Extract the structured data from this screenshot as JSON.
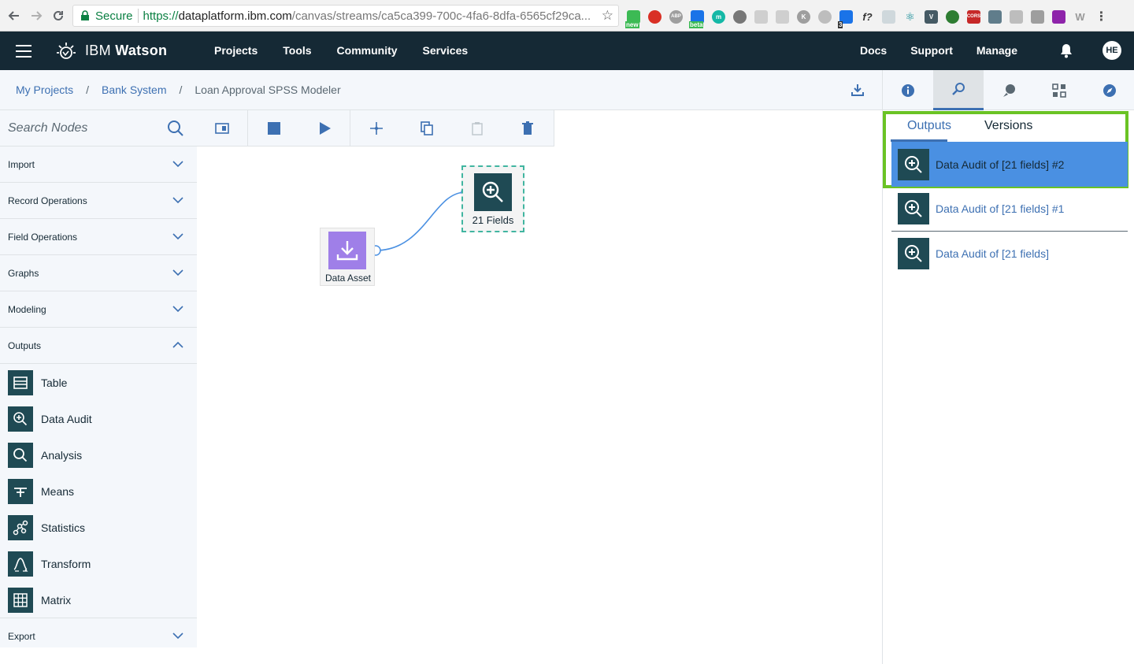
{
  "browser": {
    "secure_label": "Secure",
    "url_scheme": "https://",
    "url_host": "dataplatform.ibm.com",
    "url_path": "/canvas/streams/ca5ca399-700c-4fa6-8dfa-6565cf29ca...",
    "extension_labels": {
      "new": "new",
      "beta": "beta",
      "badge_count": "3"
    }
  },
  "header": {
    "brand_prefix": "IBM ",
    "brand_name": "Watson",
    "nav": [
      "Projects",
      "Tools",
      "Community",
      "Services"
    ],
    "right_nav": [
      "Docs",
      "Support",
      "Manage"
    ],
    "avatar_initials": "HE"
  },
  "breadcrumb": {
    "items": [
      "My Projects",
      "Bank System"
    ],
    "separator": "/",
    "current": "Loan Approval SPSS Modeler"
  },
  "palette": {
    "search_placeholder": "Search Nodes",
    "categories_top": [
      "Import",
      "Record Operations",
      "Field Operations",
      "Graphs",
      "Modeling",
      "Outputs"
    ],
    "output_nodes": [
      "Table",
      "Data Audit",
      "Analysis",
      "Means",
      "Statistics",
      "Transform",
      "Matrix"
    ],
    "category_bottom": "Export"
  },
  "canvas": {
    "nodes": [
      {
        "label": "Data Asset",
        "icon": "download-icon"
      },
      {
        "label": "21 Fields",
        "icon": "zoom-in-icon"
      }
    ]
  },
  "right_panel": {
    "tabs": [
      "info-icon",
      "search-results-icon",
      "chat-icon",
      "grid-icon",
      "compass-icon"
    ],
    "active_tab": 1,
    "subtabs": [
      "Outputs",
      "Versions"
    ],
    "outputs": [
      "Data Audit of [21 fields] #2",
      "Data Audit of [21 fields] #1",
      "Data Audit of [21 fields]"
    ]
  },
  "colors": {
    "header_bg": "#152935",
    "accent": "#3d70b2",
    "highlight_border": "#6ac324",
    "selected_row": "#4a90e2",
    "node_teal": "#1f4a54",
    "data_asset_purple": "#9f7fe8"
  }
}
